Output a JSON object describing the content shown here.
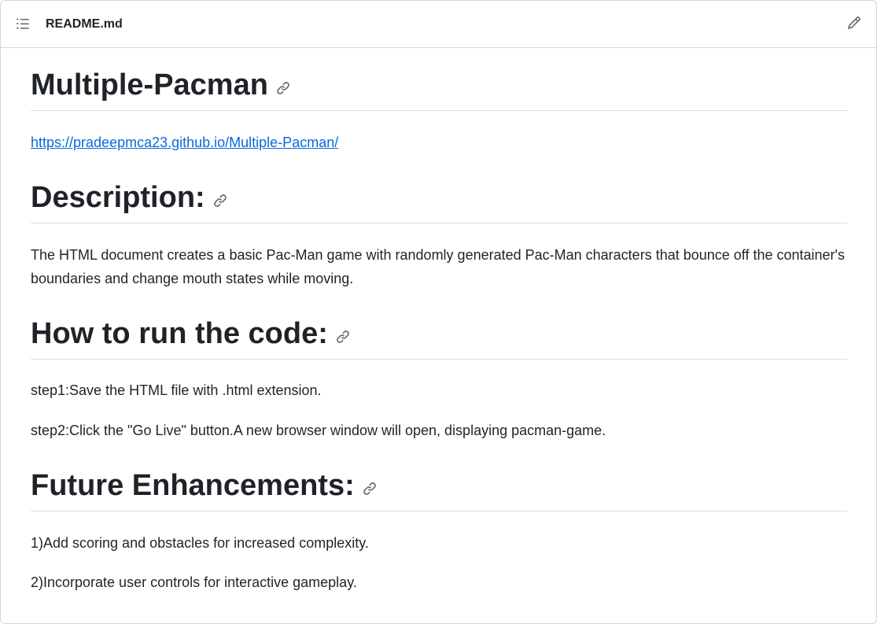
{
  "header": {
    "filename": "README.md",
    "outline_icon": "list-unordered-icon",
    "edit_icon": "pencil-icon"
  },
  "readme": {
    "title": "Multiple-Pacman",
    "link_text": "https://pradeepmca23.github.io/Multiple-Pacman/",
    "sections": [
      {
        "heading": "Description:",
        "paragraphs": [
          "The HTML document creates a basic Pac-Man game with randomly generated Pac-Man characters that bounce off the container's boundaries and change mouth states while moving."
        ]
      },
      {
        "heading": "How to run the code:",
        "paragraphs": [
          "step1:Save the HTML file with .html extension.",
          "step2:Click the \"Go Live\" button.A new browser window will open, displaying pacman-game."
        ]
      },
      {
        "heading": "Future Enhancements:",
        "paragraphs": [
          "1)Add scoring and obstacles for increased complexity.",
          "2)Incorporate user controls for interactive gameplay."
        ]
      }
    ]
  },
  "colors": {
    "text": "#1f2328",
    "link": "#0969da",
    "muted_icon": "#656d76",
    "border": "#d0d7de"
  }
}
